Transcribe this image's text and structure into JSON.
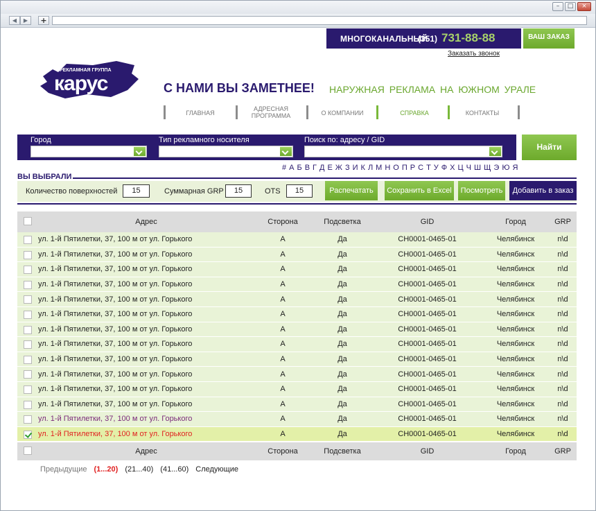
{
  "header": {
    "phone_label": "МНОГОКАНАЛЬНЫЙ",
    "phone_code": "(351)",
    "phone_number": "731-88-88",
    "order_button": "ВАШ ЗАКАЗ",
    "callback_link": "Заказать звонок",
    "logo_small": "РЕКЛАМНАЯ ГРУППА",
    "logo_big": "карус",
    "slogan": "С НАМИ ВЫ ЗАМЕТНЕЕ!",
    "tagline": "НАРУЖНАЯ РЕКЛАМА НА ЮЖНОМ УРАЛЕ"
  },
  "nav": [
    {
      "label": "ГЛАВНАЯ"
    },
    {
      "label": "АДРЕСНАЯ ПРОГРАММА"
    },
    {
      "label": "О КОМПАНИИ"
    },
    {
      "label": "СПРАВКА"
    },
    {
      "label": "КОНТАКТЫ"
    }
  ],
  "search": {
    "city_label": "Город",
    "type_label": "Тип рекламного носителя",
    "query_label": "Поиск по: адресу / GID",
    "find_button": "Найти"
  },
  "selected": {
    "title": "ВЫ ВЫБРАЛИ",
    "surfaces_label": "Количество поверхностей",
    "surfaces_value": "15",
    "grp_label": "Суммарная GRP",
    "grp_value": "15",
    "ots_label": "OTS",
    "ots_value": "15",
    "print_button": "Распечатать",
    "excel_button": "Сохранить в Excel",
    "view_button": "Посмотреть",
    "add_button": "Добавить в заказ"
  },
  "alphabet": [
    "#",
    "А",
    "Б",
    "В",
    "Г",
    "Д",
    "Е",
    "Ж",
    "З",
    "И",
    "К",
    "Л",
    "М",
    "Н",
    "О",
    "П",
    "Р",
    "С",
    "Т",
    "У",
    "Ф",
    "Х",
    "Ц",
    "Ч",
    "Ш",
    "Щ",
    "Э",
    "Ю",
    "Я"
  ],
  "table": {
    "columns": [
      "Адрес",
      "Сторона",
      "Подсветка",
      "GID",
      "Город",
      "GRP"
    ],
    "rows": [
      {
        "address": "ул. 1-й Пятилетки, 37, 100 м от ул. Горького",
        "side": "А",
        "light": "Да",
        "gid": "CH0001-0465-01",
        "city": "Челябинск",
        "grp": "n\\d",
        "state": ""
      },
      {
        "address": "ул. 1-й Пятилетки, 37, 100 м от ул. Горького",
        "side": "А",
        "light": "Да",
        "gid": "CH0001-0465-01",
        "city": "Челябинск",
        "grp": "n\\d",
        "state": ""
      },
      {
        "address": "ул. 1-й Пятилетки, 37, 100 м от ул. Горького",
        "side": "А",
        "light": "Да",
        "gid": "CH0001-0465-01",
        "city": "Челябинск",
        "grp": "n\\d",
        "state": ""
      },
      {
        "address": "ул. 1-й Пятилетки, 37, 100 м от ул. Горького",
        "side": "А",
        "light": "Да",
        "gid": "CH0001-0465-01",
        "city": "Челябинск",
        "grp": "n\\d",
        "state": ""
      },
      {
        "address": "ул. 1-й Пятилетки, 37, 100 м от ул. Горького",
        "side": "А",
        "light": "Да",
        "gid": "CH0001-0465-01",
        "city": "Челябинск",
        "grp": "n\\d",
        "state": ""
      },
      {
        "address": "ул. 1-й Пятилетки, 37, 100 м от ул. Горького",
        "side": "А",
        "light": "Да",
        "gid": "CH0001-0465-01",
        "city": "Челябинск",
        "grp": "n\\d",
        "state": ""
      },
      {
        "address": "ул. 1-й Пятилетки, 37, 100 м от ул. Горького",
        "side": "А",
        "light": "Да",
        "gid": "CH0001-0465-01",
        "city": "Челябинск",
        "grp": "n\\d",
        "state": ""
      },
      {
        "address": "ул. 1-й Пятилетки, 37, 100 м от ул. Горького",
        "side": "А",
        "light": "Да",
        "gid": "CH0001-0465-01",
        "city": "Челябинск",
        "grp": "n\\d",
        "state": ""
      },
      {
        "address": "ул. 1-й Пятилетки, 37, 100 м от ул. Горького",
        "side": "А",
        "light": "Да",
        "gid": "CH0001-0465-01",
        "city": "Челябинск",
        "grp": "n\\d",
        "state": ""
      },
      {
        "address": "ул. 1-й Пятилетки, 37, 100 м от ул. Горького",
        "side": "А",
        "light": "Да",
        "gid": "CH0001-0465-01",
        "city": "Челябинск",
        "grp": "n\\d",
        "state": ""
      },
      {
        "address": "ул. 1-й Пятилетки, 37, 100 м от ул. Горького",
        "side": "А",
        "light": "Да",
        "gid": "CH0001-0465-01",
        "city": "Челябинск",
        "grp": "n\\d",
        "state": ""
      },
      {
        "address": "ул. 1-й Пятилетки, 37, 100 м от ул. Горького",
        "side": "А",
        "light": "Да",
        "gid": "CH0001-0465-01",
        "city": "Челябинск",
        "grp": "n\\d",
        "state": ""
      },
      {
        "address": "ул. 1-й Пятилетки, 37, 100 м от ул. Горького",
        "side": "А",
        "light": "Да",
        "gid": "CH0001-0465-01",
        "city": "Челябинск",
        "grp": "n\\d",
        "state": "visited"
      },
      {
        "address": "ул. 1-й Пятилетки, 37, 100 м от ул. Горького",
        "side": "А",
        "light": "Да",
        "gid": "CH0001-0465-01",
        "city": "Челябинск",
        "grp": "n\\d",
        "state": "selected"
      }
    ]
  },
  "pager": {
    "prev": "Предыдущие",
    "current": "(1...20)",
    "page2": "(21...40)",
    "page3": "(41...60)",
    "next": "Следующие"
  },
  "colors": {
    "brand_dark": "#2a1a6e",
    "brand_green": "#6daa2c",
    "row_bg": "#e9f3d7",
    "selected_row": "#e3f0a8",
    "selected_text": "#e02020",
    "visited_text": "#7a2a7a"
  }
}
